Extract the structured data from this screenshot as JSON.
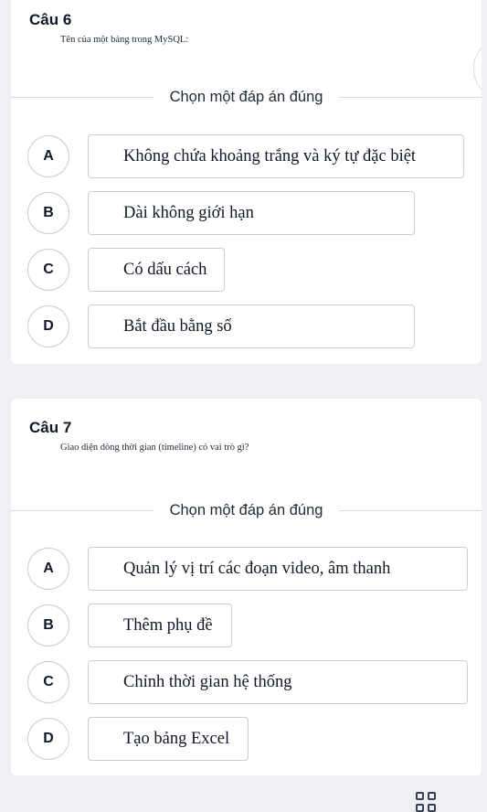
{
  "questions": [
    {
      "number": "Câu 6",
      "text": "Tên của một bảng trong MySQL:",
      "instruction": "Chọn một đáp án đúng",
      "options": [
        {
          "letter": "A",
          "text": "Không chứa khoảng trắng và ký tự đặc biệt"
        },
        {
          "letter": "B",
          "text": "Dài không giới hạn"
        },
        {
          "letter": "C",
          "text": "Có dấu cách"
        },
        {
          "letter": "D",
          "text": "Bắt đầu bằng số"
        }
      ]
    },
    {
      "number": "Câu 7",
      "text": "Giao diện dòng thời gian (timeline) có vai trò gì?",
      "instruction": "Chọn một đáp án đúng",
      "options": [
        {
          "letter": "A",
          "text": "Quản lý vị trí các đoạn video, âm thanh"
        },
        {
          "letter": "B",
          "text": "Thêm phụ đề"
        },
        {
          "letter": "C",
          "text": "Chỉnh thời gian hệ thống"
        },
        {
          "letter": "D",
          "text": "Tạo bảng Excel"
        }
      ]
    }
  ],
  "icons": {
    "question_grid": "grid-icon"
  }
}
